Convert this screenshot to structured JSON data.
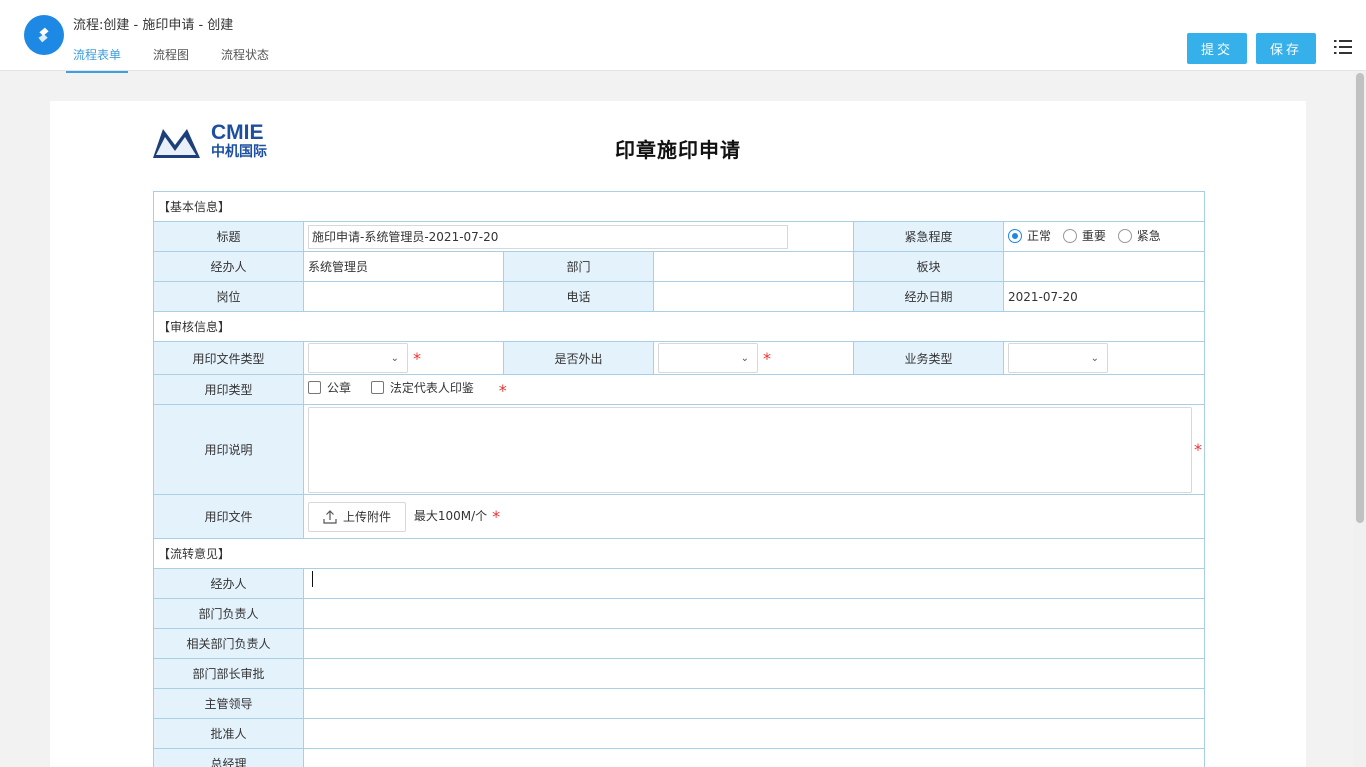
{
  "header": {
    "title": "流程:创建 - 施印申请 - 创建",
    "tabs": [
      "流程表单",
      "流程图",
      "流程状态"
    ],
    "submit_label": "提交",
    "save_label": "保存"
  },
  "brand": {
    "name": "CMIE",
    "sub": "中机国际"
  },
  "form": {
    "title": "印章施印申请",
    "sections": {
      "basic": "【基本信息】",
      "review": "【审核信息】",
      "flow": "【流转意见】"
    },
    "labels": {
      "title": "标题",
      "urgency": "紧急程度",
      "handler": "经办人",
      "dept": "部门",
      "block": "板块",
      "position": "岗位",
      "phone": "电话",
      "handle_date": "经办日期",
      "doc_type": "用印文件类型",
      "out": "是否外出",
      "biz_type": "业务类型",
      "seal_type": "用印类型",
      "desc": "用印说明",
      "files": "用印文件"
    },
    "values": {
      "title": "施印申请-系统管理员-2021-07-20",
      "handler": "系统管理员",
      "handle_date": "2021-07-20"
    },
    "urgency_options": [
      "正常",
      "重要",
      "紧急"
    ],
    "urgency_selected": "正常",
    "seal_options": [
      "公章",
      "法定代表人印鉴"
    ],
    "upload_label": "上传附件",
    "upload_hint": "最大100M/个",
    "required_mark": "*",
    "opinions": [
      "经办人",
      "部门负责人",
      "相关部门负责人",
      "部门部长审批",
      "主管领导",
      "批准人",
      "总经理"
    ]
  }
}
